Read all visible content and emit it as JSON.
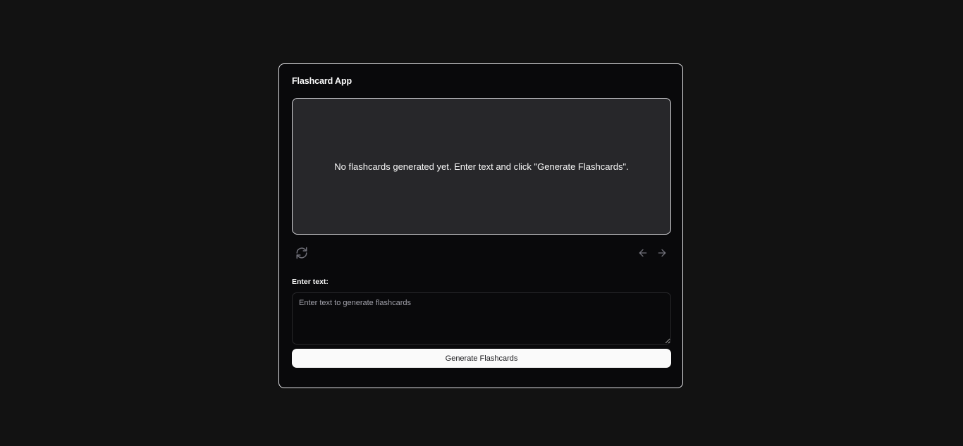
{
  "app": {
    "title": "Flashcard App"
  },
  "flashcard": {
    "empty_message": "No flashcards generated yet. Enter text and click \"Generate Flashcards\"."
  },
  "controls": {
    "flip_icon": "refresh-icon",
    "prev_icon": "arrow-left-icon",
    "next_icon": "arrow-right-icon"
  },
  "input": {
    "label": "Enter text:",
    "value": "",
    "placeholder": "Enter text to generate flashcards"
  },
  "generate_button": {
    "label": "Generate Flashcards"
  },
  "colors": {
    "page_background": "#121212",
    "card_background": "#09090b",
    "flashcard_background": "#27272a",
    "icon_muted": "#71717a",
    "button_background": "#fafafa"
  }
}
